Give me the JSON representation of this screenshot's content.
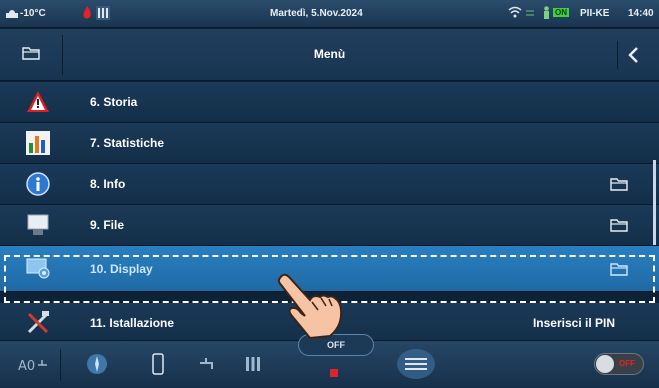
{
  "status": {
    "temperature": "-10°C",
    "date": "Martedì, 5.Nov.2024",
    "mode": "ON",
    "device": "PII-KE",
    "time": "14:40"
  },
  "header": {
    "title": "Menù"
  },
  "menu": {
    "items": [
      {
        "label": "6. Storia",
        "icon": "warning-icon"
      },
      {
        "label": "7. Statistiche",
        "icon": "bar-chart-icon"
      },
      {
        "label": "8. Info",
        "icon": "info-icon"
      },
      {
        "label": "9. File",
        "icon": "usb-drive-icon"
      },
      {
        "label": "10. Display",
        "icon": "display-settings-icon"
      },
      {
        "label": "11. Istallazione",
        "icon": "tools-icon",
        "right_text": "Inserisci il PIN"
      }
    ]
  },
  "bottom": {
    "center_label": "OFF",
    "toggle_label": "OFF"
  },
  "colors": {
    "accent_selected": "#2a7fc0",
    "status_red": "#e0222a",
    "mode_green": "#3fd23f"
  }
}
